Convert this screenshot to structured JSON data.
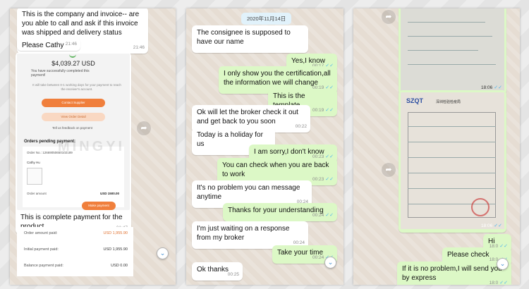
{
  "panel1": {
    "msg1": {
      "text": "This is the company and invoice-- are you able to call and ask if this invoice was shipped and delivery status please?",
      "time": "21:46"
    },
    "msg2": {
      "text": "Please Cathy",
      "time": "21:46"
    },
    "shot": {
      "amount": "$4,039.27 USD",
      "success": "You have successfully completed this payment!",
      "note": "It will take between 0-1 working days for your payment to reach the receiver's account.",
      "contact": "Contact Supplier",
      "view": "View Order Detail",
      "feedback": "Tell us feedback on payment",
      "pending": "Orders pending payment:",
      "orderno": "Order No.: 12669050650102189",
      "name": "Cathy Hu",
      "order_amount_label": "Order amount",
      "order_amount_value": "USD 1500.00",
      "make_payment": "Make payment"
    },
    "msg3": {
      "text": "This is complete payment for the product",
      "time": "21:47"
    },
    "rows": [
      {
        "label": "Order amount paid:",
        "value": "USD 1,955.90"
      },
      {
        "label": "Initial payment paid:",
        "value": "USD 1,955.90"
      },
      {
        "label": "Balance payment paid:",
        "value": "USD 0.00"
      }
    ]
  },
  "panel2": {
    "date": "2020年11月14日",
    "messages": [
      {
        "side": "in",
        "text": "The consignee is supposed to have our name",
        "time": ""
      },
      {
        "side": "out",
        "text": "Yes,I know",
        "time": "00:17"
      },
      {
        "side": "out",
        "text": "I only show you the certification,all the information we will change",
        "time": "00:19"
      },
      {
        "side": "out",
        "text": "This is the template",
        "time": "00:19"
      },
      {
        "side": "in",
        "text": "Ok will let the broker check it out and get back to you soon",
        "time": "00:22"
      },
      {
        "side": "in",
        "text": "Today is a holiday for us",
        "time": "00:22"
      },
      {
        "side": "out",
        "text": "I am sorry,I don't know",
        "time": "00:23"
      },
      {
        "side": "out",
        "text": "You can check when you are back to work",
        "time": "00:23"
      },
      {
        "side": "in",
        "text": "It's no problem you can message anytime",
        "time": "00:24"
      },
      {
        "side": "out",
        "text": "Thanks for your understanding",
        "time": "00:24"
      },
      {
        "side": "in",
        "text": "I'm just waiting on a response from my broker",
        "time": "00:24"
      },
      {
        "side": "out",
        "text": "Take your time",
        "time": "00:24"
      },
      {
        "side": "in",
        "text": "Ok thanks",
        "time": "00:25"
      }
    ]
  },
  "panel3": {
    "img1_time": "18:06",
    "img2_time": "18:06",
    "doc_logo": "SZQT",
    "doc_title": "深圳检验检疫局",
    "messages": [
      {
        "side": "out",
        "text": "Hi",
        "time": "18:0"
      },
      {
        "side": "out",
        "text": "Please check",
        "time": "18:0"
      },
      {
        "side": "out",
        "text": "If it is no problem,I will send you by express",
        "time": "18:0"
      }
    ]
  },
  "watermark": "MINGYI",
  "colors": {
    "incoming": "#ffffff",
    "outgoing": "#dcf8c6",
    "tick": "#4fb6ec",
    "chat_bg": "#e6ddd3",
    "orange": "#f07f3c"
  }
}
